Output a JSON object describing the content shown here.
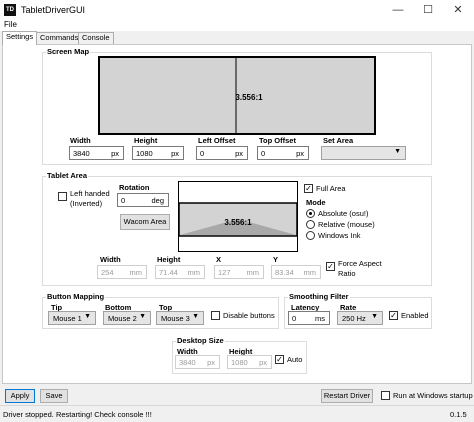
{
  "window": {
    "app_icon_text": "TD",
    "title": "TabletDriverGUI"
  },
  "menu": {
    "file": "File"
  },
  "tabs": [
    "Settings",
    "Commands",
    "Console"
  ],
  "screen_map": {
    "title": "Screen Map",
    "preview_ratio": "3.556:1",
    "width": {
      "label": "Width",
      "value": "3840",
      "unit": "px"
    },
    "height": {
      "label": "Height",
      "value": "1080",
      "unit": "px"
    },
    "left_offset": {
      "label": "Left Offset",
      "value": "0",
      "unit": "px"
    },
    "top_offset": {
      "label": "Top Offset",
      "value": "0",
      "unit": "px"
    },
    "set_area": {
      "label": "Set Area",
      "value": ""
    }
  },
  "tablet_area": {
    "title": "Tablet Area",
    "left_handed_label": "Left handed (Inverted)",
    "left_handed_checked": false,
    "rotation": {
      "label": "Rotation",
      "value": "0",
      "unit": "deg"
    },
    "wacom_area_button": "Wacom Area",
    "preview_ratio": "3.556:1",
    "full_area": {
      "label": "Full Area",
      "checked": true
    },
    "mode": {
      "label": "Mode",
      "options": [
        "Absolute (osu!)",
        "Relative (mouse)",
        "Windows Ink"
      ],
      "selected_index": 0
    },
    "width": {
      "label": "Width",
      "value": "254",
      "unit": "mm"
    },
    "height": {
      "label": "Height",
      "value": "71.44",
      "unit": "mm"
    },
    "x": {
      "label": "X",
      "value": "127",
      "unit": "mm"
    },
    "y": {
      "label": "Y",
      "value": "83.34",
      "unit": "mm"
    },
    "force_aspect": {
      "label": "Force Aspect Ratio",
      "checked": true
    }
  },
  "button_mapping": {
    "title": "Button Mapping",
    "tip": {
      "label": "Tip",
      "value": "Mouse 1"
    },
    "bottom": {
      "label": "Bottom",
      "value": "Mouse 2"
    },
    "top": {
      "label": "Top",
      "value": "Mouse 3"
    },
    "disable_buttons": {
      "label": "Disable buttons",
      "checked": false
    }
  },
  "smoothing": {
    "title": "Smoothing Filter",
    "latency": {
      "label": "Latency",
      "value": "0",
      "unit": "ms"
    },
    "rate": {
      "label": "Rate",
      "value": "250 Hz"
    },
    "enabled": {
      "label": "Enabled",
      "checked": true
    }
  },
  "desktop_size": {
    "title": "Desktop Size",
    "width": {
      "label": "Width",
      "value": "3840",
      "unit": "px"
    },
    "height": {
      "label": "Height",
      "value": "1080",
      "unit": "px"
    },
    "auto": {
      "label": "Auto",
      "checked": true
    }
  },
  "buttons": {
    "apply": "Apply",
    "save": "Save",
    "restart_driver": "Restart Driver"
  },
  "run_at_startup": {
    "label": "Run at Windows startup",
    "checked": false
  },
  "status": {
    "message": "Driver stopped. Restarting! Check console !!!",
    "version": "0.1.5"
  }
}
